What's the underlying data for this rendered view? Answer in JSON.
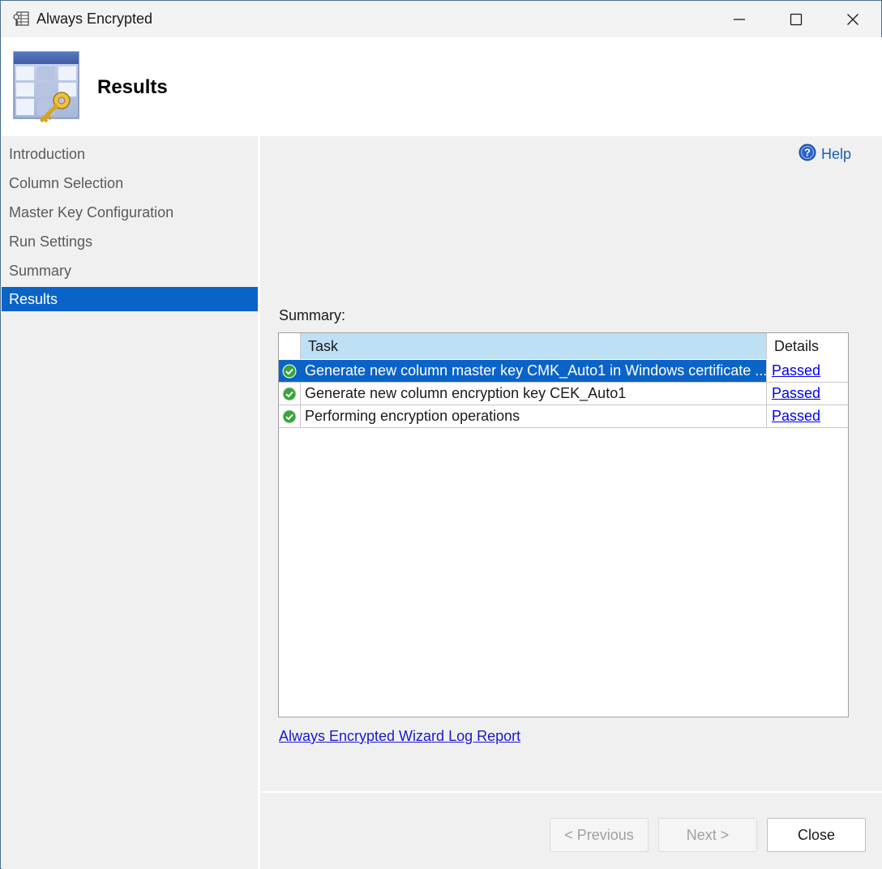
{
  "window": {
    "title": "Always Encrypted"
  },
  "header": {
    "title": "Results"
  },
  "sidebar": {
    "items": [
      {
        "label": "Introduction"
      },
      {
        "label": "Column Selection"
      },
      {
        "label": "Master Key Configuration"
      },
      {
        "label": "Run Settings"
      },
      {
        "label": "Summary"
      },
      {
        "label": "Results"
      }
    ],
    "active_index": 5
  },
  "help": {
    "label": "Help"
  },
  "summary": {
    "label": "Summary:",
    "columns": {
      "task": "Task",
      "details": "Details"
    },
    "rows": [
      {
        "task": "Generate new column master key CMK_Auto1 in Windows certificate ...",
        "details": "Passed",
        "status_icon": "check-success-icon",
        "selected": true
      },
      {
        "task": "Generate new column encryption key CEK_Auto1",
        "details": "Passed",
        "status_icon": "check-success-icon",
        "selected": false
      },
      {
        "task": "Performing encryption operations",
        "details": "Passed",
        "status_icon": "check-success-icon",
        "selected": false
      }
    ]
  },
  "log_link": "Always Encrypted Wizard Log Report",
  "footer": {
    "previous": "< Previous",
    "next": "Next >",
    "close": "Close"
  },
  "colors": {
    "selection": "#0a64c8",
    "header_task": "#bee0f4",
    "link": "#0000ee",
    "success": "#3aa53a"
  }
}
